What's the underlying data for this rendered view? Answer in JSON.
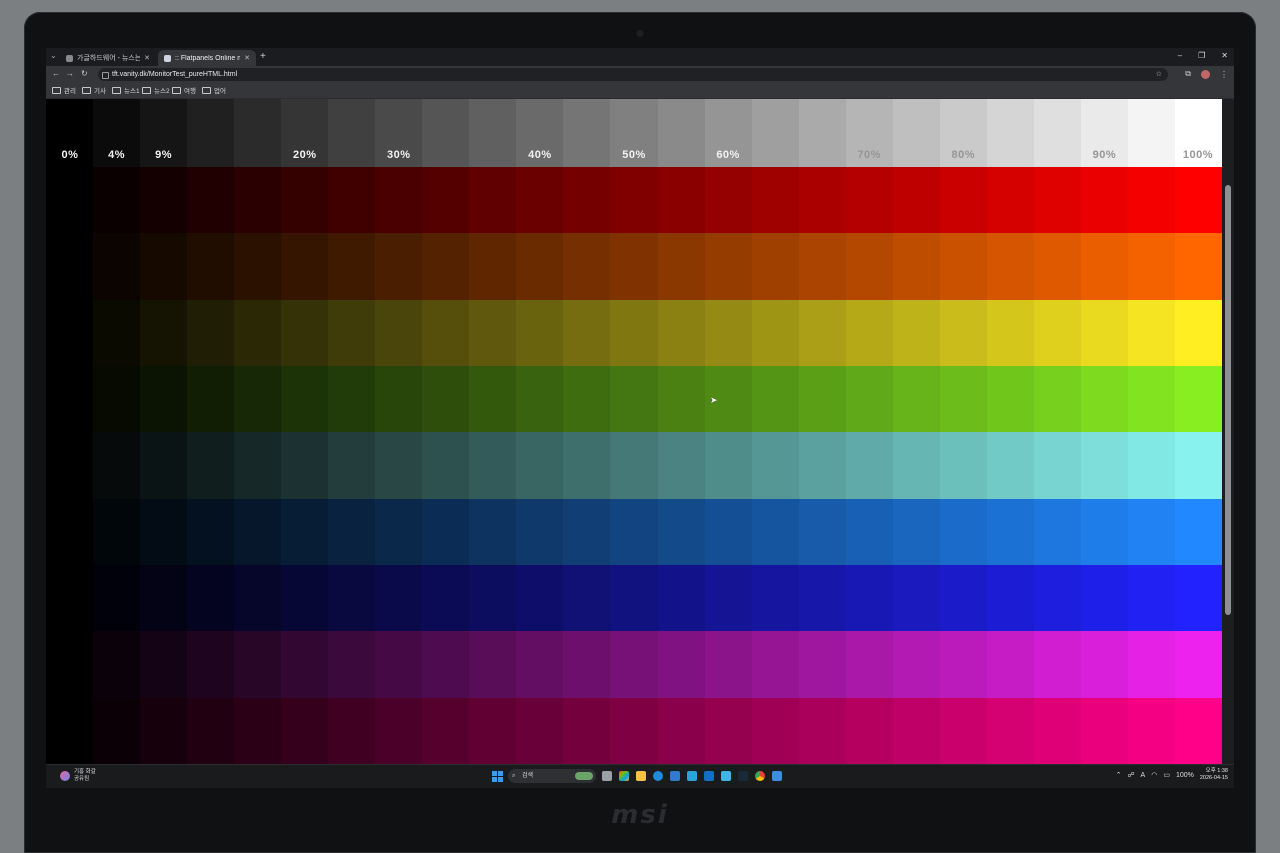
{
  "browser": {
    "tabs": [
      {
        "title": "가글하드웨어 - 뉴스는 가글"
      },
      {
        "title": ":: Flatpanels Online monitor te"
      }
    ],
    "url": "tft.vanity.dk/MonitorTest_pureHTML.html",
    "bookmarks": [
      "관리",
      "기사",
      "뉴스1",
      "뉴스2",
      "여행",
      "업어"
    ]
  },
  "monitor_test": {
    "percent_labels": [
      "0%",
      "4%",
      "9%",
      "20%",
      "30%",
      "40%",
      "50%",
      "60%",
      "70%",
      "80%",
      "90%",
      "100%"
    ],
    "steps": 25,
    "rows": [
      {
        "name": "gray",
        "color": "#ffffff"
      },
      {
        "name": "red",
        "color": "#ff0000"
      },
      {
        "name": "orange",
        "color": "#ff6600"
      },
      {
        "name": "yellow",
        "color": "#ffee22"
      },
      {
        "name": "green",
        "color": "#88ee22"
      },
      {
        "name": "cyan",
        "color": "#88f2ee"
      },
      {
        "name": "blue",
        "color": "#2288ff"
      },
      {
        "name": "dark-blue",
        "color": "#2222ff"
      },
      {
        "name": "magenta",
        "color": "#ee22ee"
      },
      {
        "name": "pink",
        "color": "#ff0088"
      }
    ]
  },
  "taskbar": {
    "weather_line1": "기흥 화갈",
    "weather_line2": "공유됨",
    "search_placeholder": "검색",
    "battery": "100%",
    "tray_font": "A",
    "time": "오후 1:38",
    "date": "2026-04-15"
  },
  "bezel": {
    "brand": "msi"
  }
}
